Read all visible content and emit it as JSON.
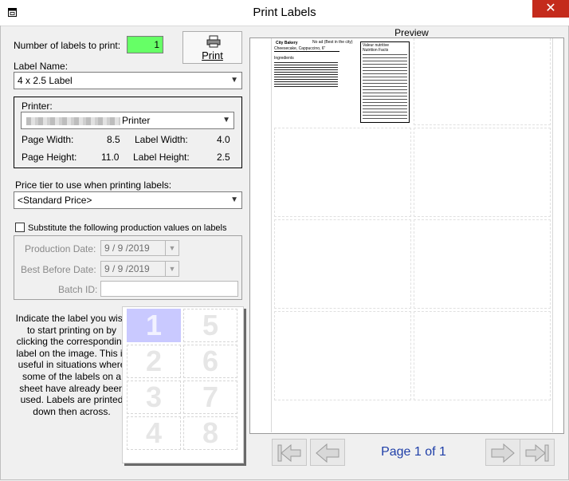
{
  "window": {
    "title": "Print Labels",
    "close": "✕"
  },
  "form": {
    "labels_to_print_label": "Number of labels to print:",
    "labels_to_print_value": "1",
    "print_button": "Print",
    "label_name_label": "Label Name:",
    "label_name_value": "4 x 2.5 Label",
    "printer_group": {
      "printer_label": "Printer:",
      "printer_value": "Printer",
      "page_width_label": "Page Width:",
      "page_width_value": "8.5",
      "label_width_label": "Label Width:",
      "label_width_value": "4.0",
      "page_height_label": "Page Height:",
      "page_height_value": "11.0",
      "label_height_label": "Label Height:",
      "label_height_value": "2.5"
    },
    "price_tier_label": "Price tier to use when printing labels:",
    "price_tier_value": "<Standard Price>",
    "substitute_label": "Substitute the following production values on labels",
    "substitute_checked": false,
    "production_date_label": "Production Date:",
    "production_date_value": "9 / 9 /2019",
    "best_before_label": "Best Before Date:",
    "best_before_value": "9 / 9 /2019",
    "batch_id_label": "Batch ID:",
    "batch_id_value": ""
  },
  "start_position": {
    "instructions": "Indicate the label you wish to start printing on by clicking the corresponding label on the image. This is useful in situations where some of the labels on a sheet have already been used. Labels are printed down then across.",
    "cells": [
      "1",
      "2",
      "3",
      "4",
      "5",
      "6",
      "7",
      "8"
    ],
    "selected": "1"
  },
  "preview": {
    "heading": "Preview",
    "page_indicator": "Page 1 of 1",
    "label": {
      "bakery": "City Bakery",
      "best_before_note": "No ad (Best in the city)",
      "product": "Cheesecake, Cappuccino, 6\"",
      "ingredients_heading": "Ingredients",
      "nutrition_title_fr": "Valeur nutritive",
      "nutrition_title_en": "Nutrition Facts"
    }
  }
}
